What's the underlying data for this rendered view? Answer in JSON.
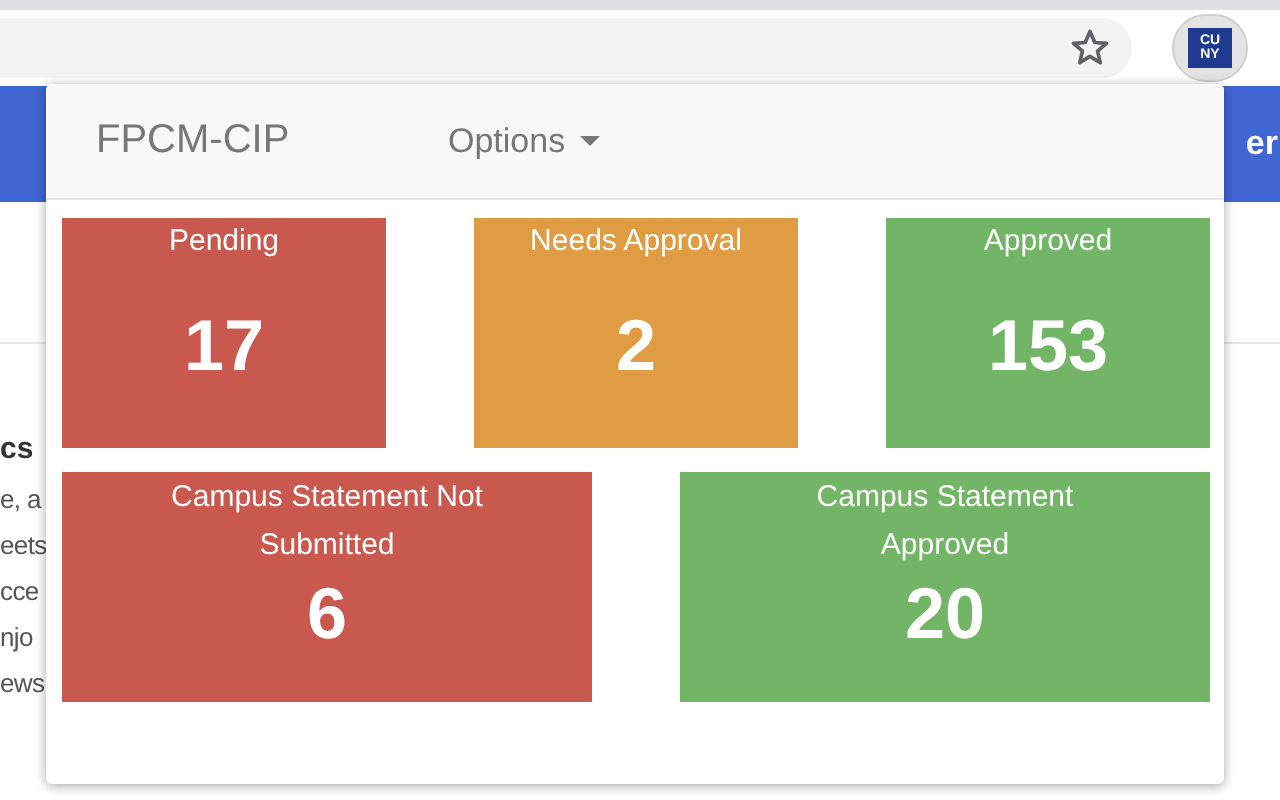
{
  "browser": {
    "extension_logo": "CU NY"
  },
  "page_behind": {
    "banner_text": "er",
    "heading": "cs",
    "lines": [
      "e, a",
      "eets",
      "cce",
      "njo",
      "ews"
    ]
  },
  "popup": {
    "title": "FPCM-CIP",
    "menu": "Options",
    "tile_groups": [
      {
        "tiles": [
          {
            "label": "Pending",
            "count": "17",
            "color": "#c9594f"
          },
          {
            "label": "Needs Approval",
            "count": "2",
            "color": "#e09c42"
          },
          {
            "label": "Approved",
            "count": "153",
            "color": "#72b566"
          }
        ]
      },
      {
        "tiles": [
          {
            "label": "Campus Statement Not Submitted",
            "count": "6",
            "color": "#c9594f"
          },
          {
            "label": "Campus Statement Approved",
            "count": "20",
            "color": "#72b566"
          }
        ]
      }
    ]
  }
}
